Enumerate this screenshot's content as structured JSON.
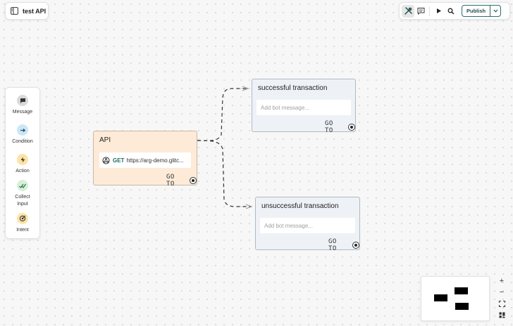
{
  "header": {
    "title": "test API",
    "sidebar_toggle_icon": "sidebar-toggle-icon"
  },
  "toolbar": {
    "icons": [
      "tools-icon",
      "comment-icon",
      "play-icon",
      "search-icon"
    ],
    "publish_label": "Publish",
    "publish_menu_icon": "chevron-down-icon"
  },
  "palette": {
    "items": [
      {
        "label": "Message",
        "icon": "message-icon",
        "color": "#d9d9d9"
      },
      {
        "label": "Condition",
        "icon": "arrow-right-icon",
        "color": "#cde6f5"
      },
      {
        "label": "Action",
        "icon": "bolt-icon",
        "color": "#fde3a7"
      },
      {
        "label": "Collect\nInput",
        "icon": "check-double-icon",
        "color": "#d6f0d9"
      },
      {
        "label": "Intent",
        "icon": "target-icon",
        "color": "#fde3a7"
      }
    ]
  },
  "nodes": {
    "api": {
      "title": "API",
      "method": "GET",
      "url": "https://arg-demo.glitc...",
      "goto_label": "GO TO",
      "color": "#fdebd8"
    },
    "success": {
      "title": "successful transaction",
      "placeholder": "Add bot message...",
      "goto_label": "GO TO",
      "color": "#eef2f6"
    },
    "fail": {
      "title": "unsuccessful transaction",
      "placeholder": "Add bot message...",
      "goto_label": "GO TO",
      "color": "#eef2f6"
    }
  },
  "zoom_controls": {
    "zoom_in": "+",
    "zoom_out": "−",
    "icons": [
      "fit-view-icon",
      "minimap-toggle-icon"
    ]
  },
  "colors": {
    "accent": "#2c6e6c",
    "api_node": "#fdebd8",
    "message_node": "#eef2f6"
  }
}
